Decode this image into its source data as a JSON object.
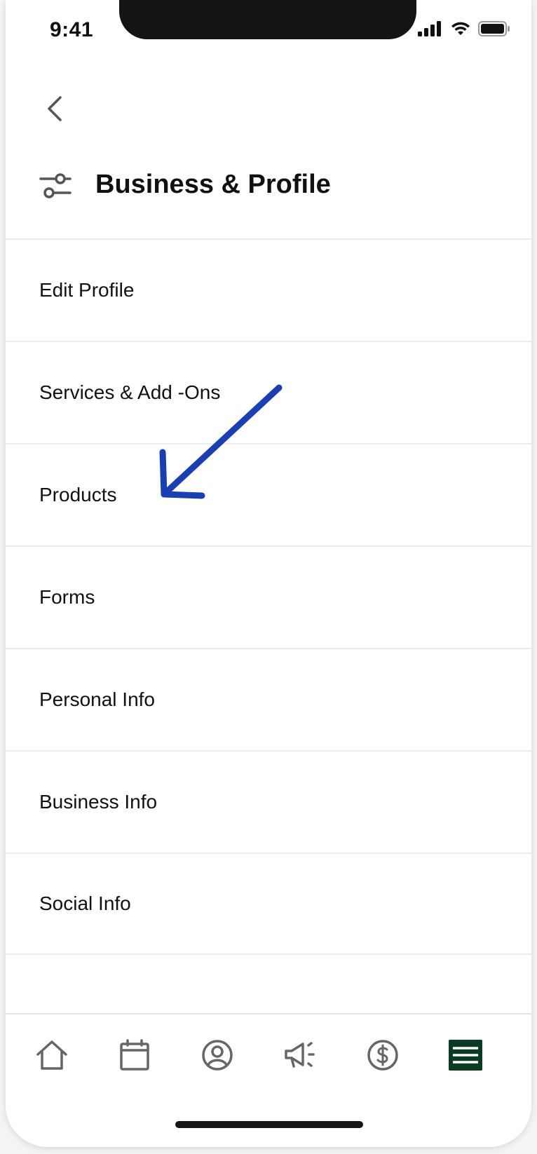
{
  "status_bar": {
    "time": "9:41"
  },
  "header": {
    "title": "Business & Profile"
  },
  "menu": {
    "items": [
      {
        "label": "Edit Profile"
      },
      {
        "label": "Services & Add -Ons"
      },
      {
        "label": "Products"
      },
      {
        "label": "Forms"
      },
      {
        "label": "Personal Info"
      },
      {
        "label": "Business Info"
      },
      {
        "label": "Social Info"
      }
    ]
  },
  "annotation": {
    "arrow_color": "#1a3fb0",
    "points_to": "Products"
  },
  "tab_bar": {
    "tabs": [
      {
        "icon": "home-icon"
      },
      {
        "icon": "calendar-icon"
      },
      {
        "icon": "profile-icon"
      },
      {
        "icon": "megaphone-icon"
      },
      {
        "icon": "dollar-icon"
      },
      {
        "icon": "menu-icon",
        "active": true
      }
    ],
    "active_color": "#0b3b24"
  }
}
